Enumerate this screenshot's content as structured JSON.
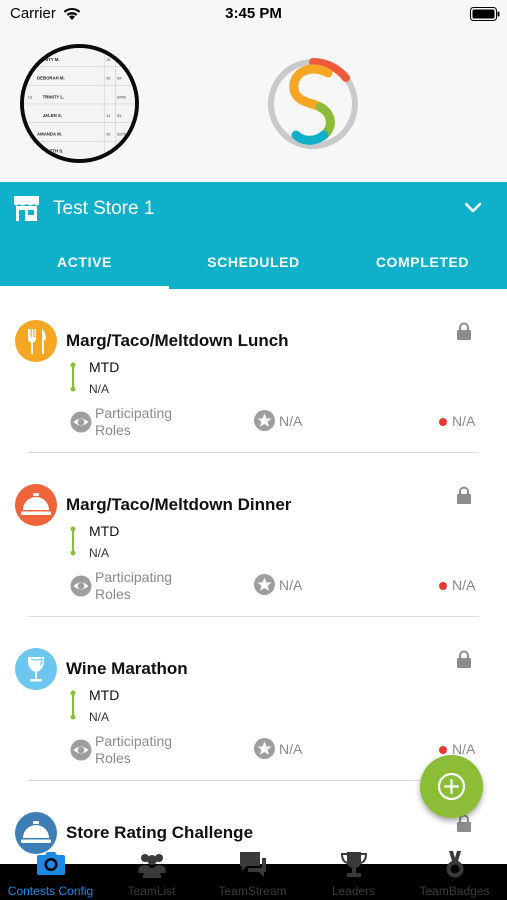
{
  "status_bar": {
    "carrier": "Carrier",
    "time": "3:45 PM"
  },
  "header": {
    "avatar_rows": [
      {
        "name": "TRINITY M.",
        "rank": "15"
      },
      {
        "name": "DEBORAH M.",
        "rank": "16"
      },
      {
        "name": "TRINITY L.",
        "rank": "13"
      },
      {
        "name": "JALEN S.",
        "rank": "14"
      },
      {
        "name": "AMANDA M.",
        "rank": "16"
      },
      {
        "name": "BETH S.",
        "rank": ""
      }
    ],
    "avatar_values": [
      "$1",
      "$4",
      "$450",
      "$1",
      "$378",
      "$1"
    ]
  },
  "store": {
    "name": "Test Store 1"
  },
  "tabs": [
    {
      "label": "ACTIVE",
      "selected": true
    },
    {
      "label": "SCHEDULED",
      "selected": false
    },
    {
      "label": "COMPLETED",
      "selected": false
    }
  ],
  "contests": [
    {
      "title": "Marg/Taco/Meltdown Lunch",
      "icon": "utensils-icon",
      "icon_color": "#f5a623",
      "period": "MTD",
      "goal": "N/A",
      "roles_label": "Participating Roles",
      "reward": "N/A",
      "status": "N/A"
    },
    {
      "title": "Marg/Taco/Meltdown Dinner",
      "icon": "service-bell-icon",
      "icon_color": "#f0643c",
      "period": "MTD",
      "goal": "N/A",
      "roles_label": "Participating Roles",
      "reward": "N/A",
      "status": "N/A"
    },
    {
      "title": "Wine Marathon",
      "icon": "wine-glass-icon",
      "icon_color": "#6cc6ef",
      "period": "MTD",
      "goal": "N/A",
      "roles_label": "Participating Roles",
      "reward": "N/A",
      "status": "N/A"
    },
    {
      "title": "Store Rating Challenge",
      "icon": "service-bell-icon",
      "icon_color": "#3d7fb5",
      "period": "",
      "goal": "",
      "roles_label": "",
      "reward": "",
      "status": ""
    }
  ],
  "bottom_nav": [
    {
      "label": "Contests Config",
      "icon": "camera-icon",
      "selected": true
    },
    {
      "label": "TeamList",
      "icon": "team-icon",
      "selected": false
    },
    {
      "label": "TeamStream",
      "icon": "chat-icon",
      "selected": false
    },
    {
      "label": "Leaders",
      "icon": "trophy-icon",
      "selected": false
    },
    {
      "label": "TeamBadges",
      "icon": "badge-icon",
      "selected": false
    }
  ],
  "colors": {
    "accent": "#0fb0c9",
    "fab": "#8cbd37",
    "status_dot": "#e53935",
    "nav_selected": "#1e88e5"
  }
}
